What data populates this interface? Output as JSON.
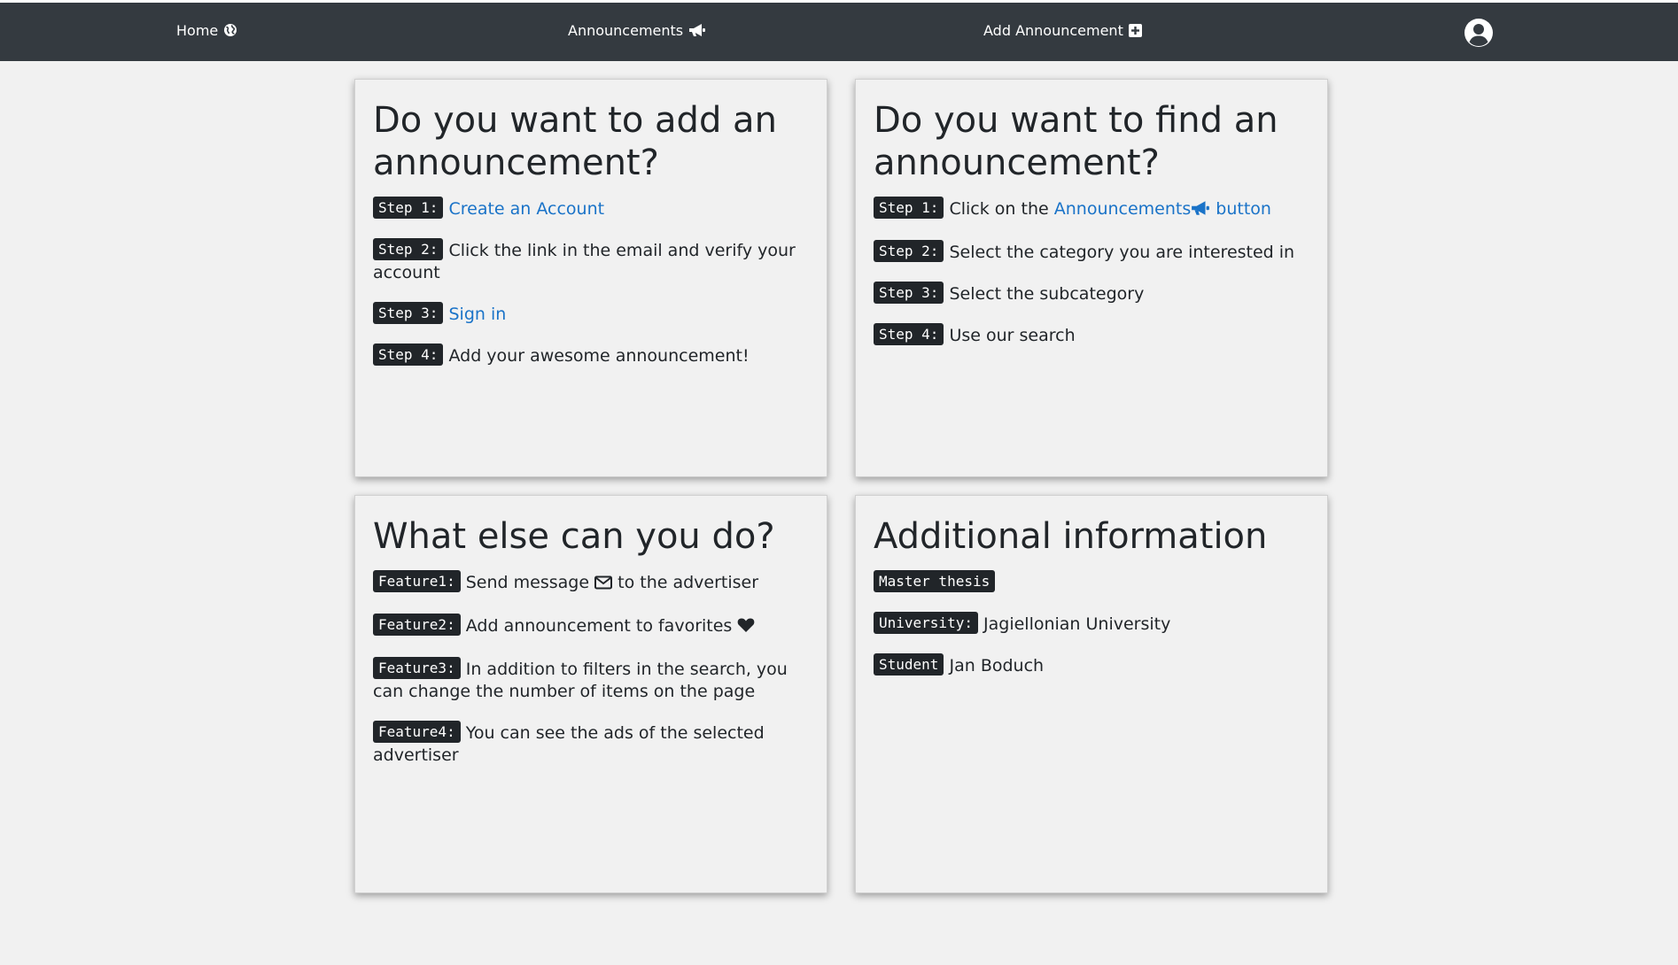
{
  "nav": {
    "home": "Home",
    "announcements": "Announcements",
    "add_announcement": "Add Announcement"
  },
  "cards": {
    "add": {
      "title": "Do you want to add an announcement?",
      "steps": [
        {
          "badge": "Step 1:",
          "link": "Create an Account"
        },
        {
          "badge": "Step 2:",
          "text": "Click the link in the email and verify your account"
        },
        {
          "badge": "Step 3:",
          "link": "Sign in"
        },
        {
          "badge": "Step 4:",
          "text": "Add your awesome announcement!"
        }
      ]
    },
    "find": {
      "title": "Do you want to find an announcement?",
      "steps": [
        {
          "badge": "Step 1:",
          "text": "Click on the",
          "link": "Announcements",
          "link_suffix": "button"
        },
        {
          "badge": "Step 2:",
          "text": "Select the category you are interested in"
        },
        {
          "badge": "Step 3:",
          "text": "Select the subcategory"
        },
        {
          "badge": "Step 4:",
          "text": "Use our search"
        }
      ]
    },
    "features": {
      "title": "What else can you do?",
      "items": [
        {
          "badge": "Feature1:",
          "text_before": "Send message",
          "text_after": "to the advertiser"
        },
        {
          "badge": "Feature2:",
          "text": "Add announcement to favorites"
        },
        {
          "badge": "Feature3:",
          "text": "In addition to filters in the search, you can change the number of items on the page"
        },
        {
          "badge": "Feature4:",
          "text": "You can see the ads of the selected advertiser"
        }
      ]
    },
    "info": {
      "title": "Additional information",
      "items": [
        {
          "badge": "Master thesis",
          "text": ""
        },
        {
          "badge": "University:",
          "text": "Jagiellonian University"
        },
        {
          "badge": "Student",
          "text": "Jan Boduch"
        }
      ]
    }
  },
  "icons": {
    "home": "globe-icon",
    "announcements": "megaphone-icon",
    "add": "plus-square-icon",
    "avatar": "user-circle-icon",
    "message": "envelope-icon",
    "favorite": "heart-icon"
  },
  "colors": {
    "navbar": "#343a40",
    "link": "#1a73c8",
    "badge": "#212529",
    "background": "#f1f1f1"
  }
}
